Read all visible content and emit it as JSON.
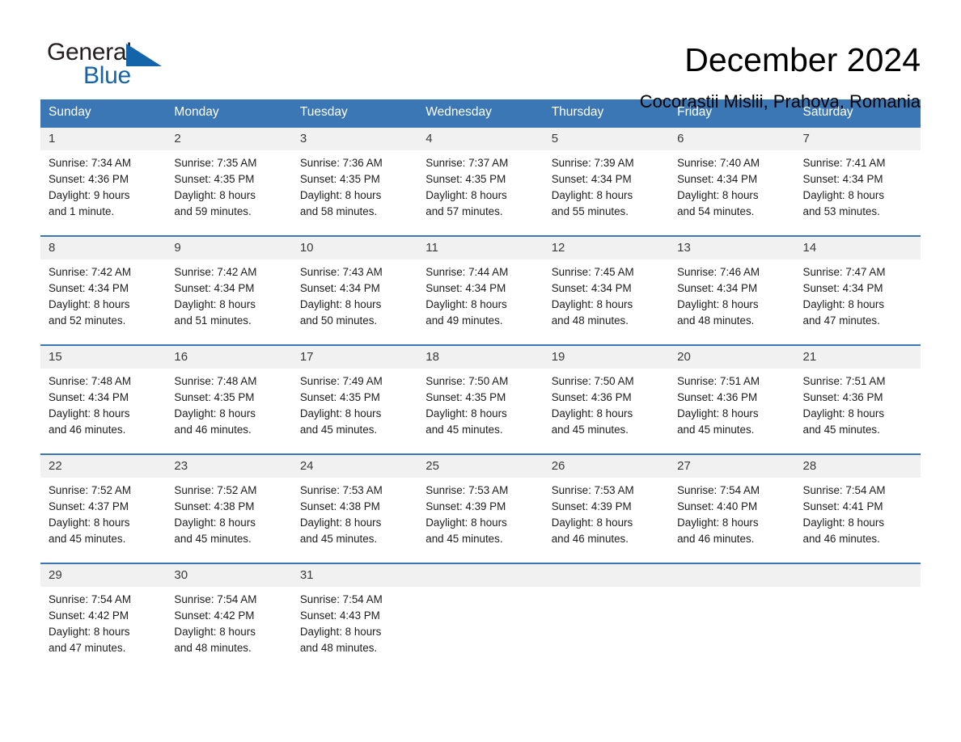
{
  "brand": {
    "name_part1": "General",
    "name_part2": "Blue",
    "logo_icon": "triangle-icon",
    "accent_color": "#1464aa"
  },
  "header": {
    "title": "December 2024",
    "location": "Cocorastii Mislii, Prahova, Romania"
  },
  "theme": {
    "header_blue": "#3b77b5",
    "daynum_bg": "#f1f1f1",
    "text": "#1c1c1c"
  },
  "calendar": {
    "weekday_headers": [
      "Sunday",
      "Monday",
      "Tuesday",
      "Wednesday",
      "Thursday",
      "Friday",
      "Saturday"
    ],
    "weeks": [
      [
        {
          "day": "1",
          "sunrise": "Sunrise: 7:34 AM",
          "sunset": "Sunset: 4:36 PM",
          "daylight_line1": "Daylight: 9 hours",
          "daylight_line2": "and 1 minute."
        },
        {
          "day": "2",
          "sunrise": "Sunrise: 7:35 AM",
          "sunset": "Sunset: 4:35 PM",
          "daylight_line1": "Daylight: 8 hours",
          "daylight_line2": "and 59 minutes."
        },
        {
          "day": "3",
          "sunrise": "Sunrise: 7:36 AM",
          "sunset": "Sunset: 4:35 PM",
          "daylight_line1": "Daylight: 8 hours",
          "daylight_line2": "and 58 minutes."
        },
        {
          "day": "4",
          "sunrise": "Sunrise: 7:37 AM",
          "sunset": "Sunset: 4:35 PM",
          "daylight_line1": "Daylight: 8 hours",
          "daylight_line2": "and 57 minutes."
        },
        {
          "day": "5",
          "sunrise": "Sunrise: 7:39 AM",
          "sunset": "Sunset: 4:34 PM",
          "daylight_line1": "Daylight: 8 hours",
          "daylight_line2": "and 55 minutes."
        },
        {
          "day": "6",
          "sunrise": "Sunrise: 7:40 AM",
          "sunset": "Sunset: 4:34 PM",
          "daylight_line1": "Daylight: 8 hours",
          "daylight_line2": "and 54 minutes."
        },
        {
          "day": "7",
          "sunrise": "Sunrise: 7:41 AM",
          "sunset": "Sunset: 4:34 PM",
          "daylight_line1": "Daylight: 8 hours",
          "daylight_line2": "and 53 minutes."
        }
      ],
      [
        {
          "day": "8",
          "sunrise": "Sunrise: 7:42 AM",
          "sunset": "Sunset: 4:34 PM",
          "daylight_line1": "Daylight: 8 hours",
          "daylight_line2": "and 52 minutes."
        },
        {
          "day": "9",
          "sunrise": "Sunrise: 7:42 AM",
          "sunset": "Sunset: 4:34 PM",
          "daylight_line1": "Daylight: 8 hours",
          "daylight_line2": "and 51 minutes."
        },
        {
          "day": "10",
          "sunrise": "Sunrise: 7:43 AM",
          "sunset": "Sunset: 4:34 PM",
          "daylight_line1": "Daylight: 8 hours",
          "daylight_line2": "and 50 minutes."
        },
        {
          "day": "11",
          "sunrise": "Sunrise: 7:44 AM",
          "sunset": "Sunset: 4:34 PM",
          "daylight_line1": "Daylight: 8 hours",
          "daylight_line2": "and 49 minutes."
        },
        {
          "day": "12",
          "sunrise": "Sunrise: 7:45 AM",
          "sunset": "Sunset: 4:34 PM",
          "daylight_line1": "Daylight: 8 hours",
          "daylight_line2": "and 48 minutes."
        },
        {
          "day": "13",
          "sunrise": "Sunrise: 7:46 AM",
          "sunset": "Sunset: 4:34 PM",
          "daylight_line1": "Daylight: 8 hours",
          "daylight_line2": "and 48 minutes."
        },
        {
          "day": "14",
          "sunrise": "Sunrise: 7:47 AM",
          "sunset": "Sunset: 4:34 PM",
          "daylight_line1": "Daylight: 8 hours",
          "daylight_line2": "and 47 minutes."
        }
      ],
      [
        {
          "day": "15",
          "sunrise": "Sunrise: 7:48 AM",
          "sunset": "Sunset: 4:34 PM",
          "daylight_line1": "Daylight: 8 hours",
          "daylight_line2": "and 46 minutes."
        },
        {
          "day": "16",
          "sunrise": "Sunrise: 7:48 AM",
          "sunset": "Sunset: 4:35 PM",
          "daylight_line1": "Daylight: 8 hours",
          "daylight_line2": "and 46 minutes."
        },
        {
          "day": "17",
          "sunrise": "Sunrise: 7:49 AM",
          "sunset": "Sunset: 4:35 PM",
          "daylight_line1": "Daylight: 8 hours",
          "daylight_line2": "and 45 minutes."
        },
        {
          "day": "18",
          "sunrise": "Sunrise: 7:50 AM",
          "sunset": "Sunset: 4:35 PM",
          "daylight_line1": "Daylight: 8 hours",
          "daylight_line2": "and 45 minutes."
        },
        {
          "day": "19",
          "sunrise": "Sunrise: 7:50 AM",
          "sunset": "Sunset: 4:36 PM",
          "daylight_line1": "Daylight: 8 hours",
          "daylight_line2": "and 45 minutes."
        },
        {
          "day": "20",
          "sunrise": "Sunrise: 7:51 AM",
          "sunset": "Sunset: 4:36 PM",
          "daylight_line1": "Daylight: 8 hours",
          "daylight_line2": "and 45 minutes."
        },
        {
          "day": "21",
          "sunrise": "Sunrise: 7:51 AM",
          "sunset": "Sunset: 4:36 PM",
          "daylight_line1": "Daylight: 8 hours",
          "daylight_line2": "and 45 minutes."
        }
      ],
      [
        {
          "day": "22",
          "sunrise": "Sunrise: 7:52 AM",
          "sunset": "Sunset: 4:37 PM",
          "daylight_line1": "Daylight: 8 hours",
          "daylight_line2": "and 45 minutes."
        },
        {
          "day": "23",
          "sunrise": "Sunrise: 7:52 AM",
          "sunset": "Sunset: 4:38 PM",
          "daylight_line1": "Daylight: 8 hours",
          "daylight_line2": "and 45 minutes."
        },
        {
          "day": "24",
          "sunrise": "Sunrise: 7:53 AM",
          "sunset": "Sunset: 4:38 PM",
          "daylight_line1": "Daylight: 8 hours",
          "daylight_line2": "and 45 minutes."
        },
        {
          "day": "25",
          "sunrise": "Sunrise: 7:53 AM",
          "sunset": "Sunset: 4:39 PM",
          "daylight_line1": "Daylight: 8 hours",
          "daylight_line2": "and 45 minutes."
        },
        {
          "day": "26",
          "sunrise": "Sunrise: 7:53 AM",
          "sunset": "Sunset: 4:39 PM",
          "daylight_line1": "Daylight: 8 hours",
          "daylight_line2": "and 46 minutes."
        },
        {
          "day": "27",
          "sunrise": "Sunrise: 7:54 AM",
          "sunset": "Sunset: 4:40 PM",
          "daylight_line1": "Daylight: 8 hours",
          "daylight_line2": "and 46 minutes."
        },
        {
          "day": "28",
          "sunrise": "Sunrise: 7:54 AM",
          "sunset": "Sunset: 4:41 PM",
          "daylight_line1": "Daylight: 8 hours",
          "daylight_line2": "and 46 minutes."
        }
      ],
      [
        {
          "day": "29",
          "sunrise": "Sunrise: 7:54 AM",
          "sunset": "Sunset: 4:42 PM",
          "daylight_line1": "Daylight: 8 hours",
          "daylight_line2": "and 47 minutes."
        },
        {
          "day": "30",
          "sunrise": "Sunrise: 7:54 AM",
          "sunset": "Sunset: 4:42 PM",
          "daylight_line1": "Daylight: 8 hours",
          "daylight_line2": "and 48 minutes."
        },
        {
          "day": "31",
          "sunrise": "Sunrise: 7:54 AM",
          "sunset": "Sunset: 4:43 PM",
          "daylight_line1": "Daylight: 8 hours",
          "daylight_line2": "and 48 minutes."
        },
        null,
        null,
        null,
        null
      ]
    ]
  }
}
